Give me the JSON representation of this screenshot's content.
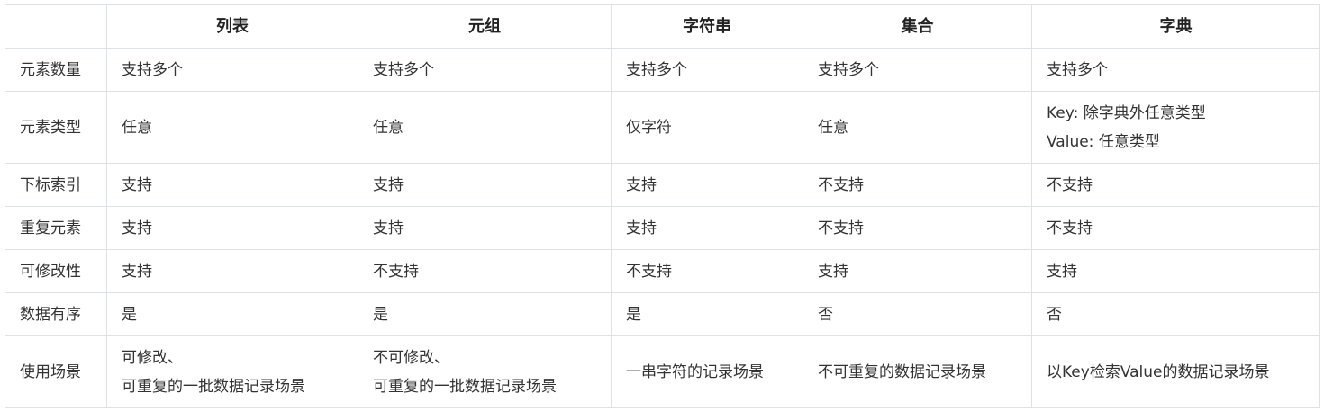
{
  "columns": [
    "",
    "列表",
    "元组",
    "字符串",
    "集合",
    "字典"
  ],
  "rows": [
    {
      "label": "元素数量",
      "cells": [
        [
          "支持多个"
        ],
        [
          "支持多个"
        ],
        [
          "支持多个"
        ],
        [
          "支持多个"
        ],
        [
          "支持多个"
        ]
      ]
    },
    {
      "label": "元素类型",
      "cells": [
        [
          "任意"
        ],
        [
          "任意"
        ],
        [
          "仅字符"
        ],
        [
          "任意"
        ],
        [
          "Key: 除字典外任意类型",
          "Value: 任意类型"
        ]
      ]
    },
    {
      "label": "下标索引",
      "cells": [
        [
          "支持"
        ],
        [
          "支持"
        ],
        [
          "支持"
        ],
        [
          "不支持"
        ],
        [
          "不支持"
        ]
      ]
    },
    {
      "label": "重复元素",
      "cells": [
        [
          "支持"
        ],
        [
          "支持"
        ],
        [
          "支持"
        ],
        [
          "不支持"
        ],
        [
          "不支持"
        ]
      ]
    },
    {
      "label": "可修改性",
      "cells": [
        [
          "支持"
        ],
        [
          "不支持"
        ],
        [
          "不支持"
        ],
        [
          "支持"
        ],
        [
          "支持"
        ]
      ]
    },
    {
      "label": "数据有序",
      "cells": [
        [
          "是"
        ],
        [
          "是"
        ],
        [
          "是"
        ],
        [
          "否"
        ],
        [
          "否"
        ]
      ]
    },
    {
      "label": "使用场景",
      "cells": [
        [
          "可修改、",
          "可重复的一批数据记录场景"
        ],
        [
          "不可修改、",
          "可重复的一批数据记录场景"
        ],
        [
          "一串字符的记录场景"
        ],
        [
          "不可重复的数据记录场景"
        ],
        [
          "以Key检索Value的数据记录场景"
        ]
      ]
    }
  ]
}
